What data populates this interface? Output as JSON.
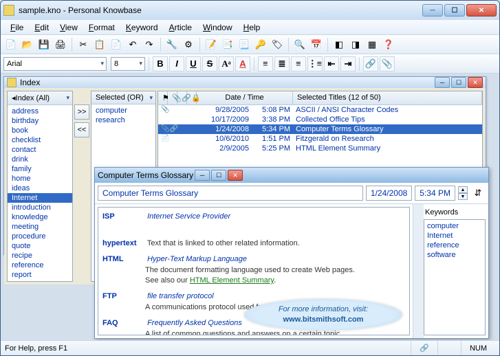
{
  "app": {
    "title": "sample.kno - Personal Knowbase",
    "window_buttons": {
      "min": "─",
      "max": "☐",
      "close": "✕"
    }
  },
  "menus": [
    "File",
    "Edit",
    "View",
    "Format",
    "Keyword",
    "Article",
    "Window",
    "Help"
  ],
  "format_bar": {
    "font": "Arial",
    "size": "8"
  },
  "status": {
    "help": "For Help, press F1",
    "num": "NUM"
  },
  "index_window": {
    "title": "Index",
    "all_header": "Index (All)",
    "selected_header": "Selected (OR)",
    "all_items": [
      "address",
      "birthday",
      "book",
      "checklist",
      "contact",
      "drink",
      "family",
      "home",
      "ideas",
      "Internet",
      "introduction",
      "knowledge",
      "meeting",
      "procedure",
      "quote",
      "recipe",
      "reference",
      "report"
    ],
    "all_selected_index": 9,
    "selected_items": [
      "computer",
      "research"
    ],
    "grid": {
      "col_date": "Date / Time",
      "col_titles": "Selected Titles (12 of 50)",
      "rows": [
        {
          "icons": "📎",
          "date": "9/28/2005",
          "time": "5:08 PM",
          "title": "ASCII / ANSI Character Codes"
        },
        {
          "icons": "",
          "date": "10/17/2009",
          "time": "3:38 PM",
          "title": "Collected Office Tips"
        },
        {
          "icons": "📎🔗",
          "date": "1/24/2008",
          "time": "5:34 PM",
          "title": "Computer Terms Glossary"
        },
        {
          "icons": "📄",
          "date": "10/6/2010",
          "time": "1:51 PM",
          "title": "Fitzgerald on Research"
        },
        {
          "icons": "",
          "date": "2/9/2005",
          "time": "5:25 PM",
          "title": "HTML Element Summary"
        }
      ],
      "selected_row": 2
    }
  },
  "article_window": {
    "title": "Computer Terms Glossary",
    "heading": "Computer Terms Glossary",
    "date": "1/24/2008",
    "time": "5:34 PM",
    "keywords_label": "Keywords",
    "keywords": [
      "computer",
      "Internet",
      "reference",
      "software"
    ],
    "defs": [
      {
        "term": "FAQ",
        "ital": "Frequently Asked Questions",
        "desc": "A list of common questions and answers on a certain topic."
      },
      {
        "term": "FTP",
        "ital": "file transfer protocol",
        "desc": "A communications protocol used for file transfers on the Internet."
      },
      {
        "term": "HTML",
        "ital": "Hyper-Text Markup Language",
        "desc": "The document formatting language used to create Web pages.",
        "extra": "See also our ",
        "link": "HTML Element Summary",
        "after": "."
      },
      {
        "term": "hypertext",
        "ital": "",
        "desc": "Text that is linked to other related information."
      },
      {
        "term": "ISP",
        "ital": "Internet Service Provider",
        "desc": ""
      }
    ]
  },
  "info": {
    "line1": "For more information, visit:",
    "line2": "www.bitsmithsoft.com"
  }
}
